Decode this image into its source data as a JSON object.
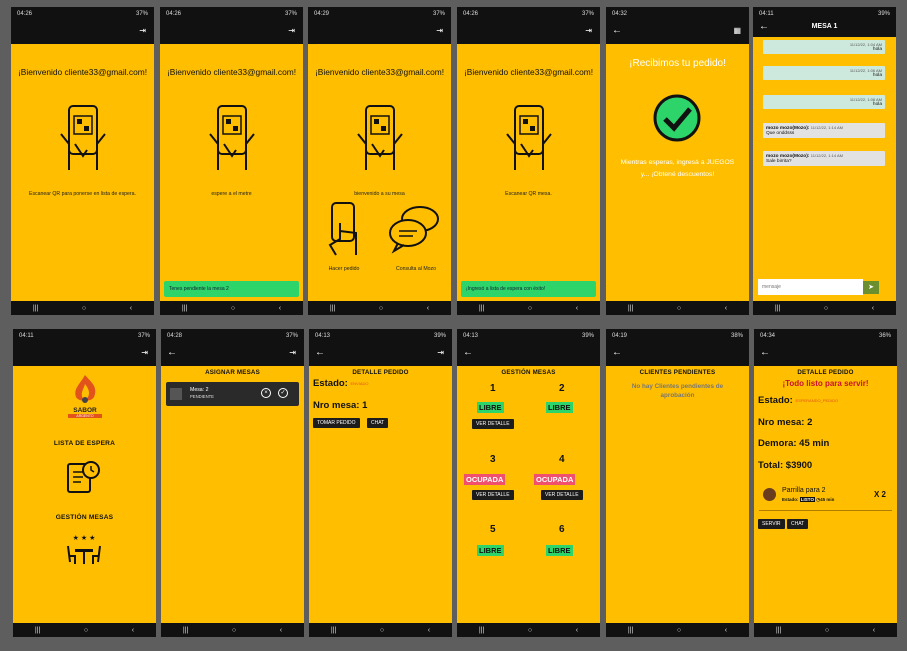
{
  "status": {
    "times": [
      "04:26",
      "04:26",
      "04:29",
      "04:26",
      "04:32",
      "04:11",
      "04:11",
      "04:28",
      "04:13",
      "04:13",
      "04:19",
      "04:34"
    ],
    "battery": [
      "37%",
      "37%",
      "37%",
      "37%",
      "",
      "39%",
      "37%",
      "37%",
      "39%",
      "39%",
      "38%",
      "36%"
    ]
  },
  "welcome": "¡Bienvenido cliente33@gmail.com!",
  "s1": {
    "caption": "Escanear QR para ponerse en lista de espera."
  },
  "s2": {
    "caption": "espere a el metre",
    "toast": "Tenes pendiente la mesa 2"
  },
  "s3": {
    "caption": "bienvenido a su mesa",
    "btn1": "Hacer pedido",
    "btn2": "Consulta al Mozo"
  },
  "s4": {
    "caption": "Escanear QR mesa.",
    "toast": "¡Ingresó a lista de espera con éxito!"
  },
  "s5": {
    "title": "¡Recibimos tu pedido!",
    "msg1": "Mientras esperas, ingresá a JUEGOS",
    "msg2": "y... ¡Obtené descuentos!"
  },
  "s6": {
    "title": "MESA 1",
    "messages": [
      {
        "time": "11/12/22, 1:04 AM",
        "text": "hola"
      },
      {
        "time": "11/12/22, 1:06 AM",
        "text": "hola"
      },
      {
        "time": "11/12/22, 1:08 AM",
        "text": "hola"
      },
      {
        "author": "mozo mozo(Mozo):",
        "time": "11/12/22, 1:14 AM",
        "text": "Que onddsss"
      },
      {
        "author": "mozo mozo(Mozo):",
        "time": "11/12/22, 1:14 AM",
        "text": "Sale birrita?"
      }
    ],
    "placeholder": "mensaje"
  },
  "s7": {
    "logo1": "SABOR",
    "logo2": "ARGENTO",
    "lista": "LISTA DE ESPERA",
    "gestion": "GESTIÓN MESAS"
  },
  "s8": {
    "title": "ASIGNAR MESAS",
    "item": "Mesa: 2",
    "state": "PENDIENTE"
  },
  "s9": {
    "title": "DETALLE PEDIDO",
    "estado": "Estado:",
    "estado_val": "ENVIADO",
    "nro": "Nro mesa: 1",
    "btn1": "TOMAR PEDIDO",
    "btn2": "CHAT"
  },
  "s10": {
    "title": "GESTIÓN MESAS",
    "tables": [
      {
        "n": "1",
        "s": "LIBRE",
        "d": "VER DETALLE"
      },
      {
        "n": "2",
        "s": "LIBRE",
        "d": ""
      },
      {
        "n": "3",
        "s": "OCUPADA",
        "d": "VER DETALLE"
      },
      {
        "n": "4",
        "s": "OCUPADA",
        "d": "VER DETALLE"
      },
      {
        "n": "5",
        "s": "LIBRE",
        "d": ""
      },
      {
        "n": "6",
        "s": "LIBRE",
        "d": ""
      }
    ]
  },
  "s11": {
    "title": "CLIENTES PENDIENTES",
    "msg": "No hay Clientes pendientes de aprobación"
  },
  "s12": {
    "title": "DETALLE PEDIDO",
    "ready": "¡Todo listo para servir!",
    "estado": "Estado:",
    "estado_val": "ESPERANDO_PEDIDO",
    "mesa": "Nro mesa: 2",
    "demora": "Demora: 45 min",
    "total": "Total: $3900",
    "item": "Parrilla para 2",
    "item_estado": "Estado:",
    "item_listo": "LISTO",
    "item_min": "45 min",
    "qty": "X 2",
    "btn1": "SERVIR",
    "btn2": "CHAT"
  },
  "colors": {
    "bg": "#ffbf00",
    "green": "#2dd46a",
    "red": "#f0506e"
  }
}
